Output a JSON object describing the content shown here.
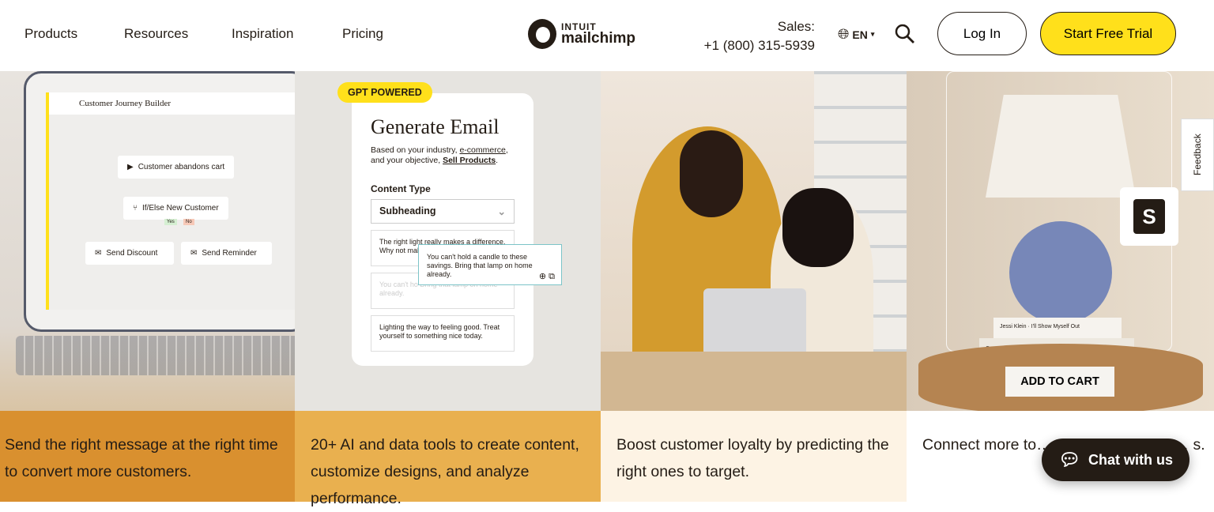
{
  "header": {
    "nav": [
      "Products",
      "Resources",
      "Inspiration",
      "Pricing"
    ],
    "logo_top": "INTUIT",
    "logo_bottom": "mailchimp",
    "sales_label": "Sales:",
    "sales_phone": "+1 (800) 315-5939",
    "language": "EN",
    "login": "Log In",
    "trial": "Start Free Trial",
    "accent": "#ffe01b"
  },
  "panel1": {
    "title": "Customer Journey Builder",
    "n1": "Customer abandons cart",
    "n2": "If/Else New Customer",
    "yes": "Yes",
    "no": "No",
    "n3": "Send Discount",
    "n4": "Send Reminder"
  },
  "panel2": {
    "badge": "GPT POWERED",
    "title": "Generate Email",
    "sub_a": "Based on your industry, ",
    "industry": "e-commerce",
    "sub_b": ", and your objective, ",
    "objective": "Sell Products",
    "content_type": "Content Type",
    "select": "Subheading",
    "opt1": "The right light really makes a difference. Why not mak",
    "opt2": "You can't ho Bring that lamp on home already.",
    "opt3": "Lighting the way to feeling good. Treat yourself to something nice today.",
    "popup": "You can't hold a candle to these savings. Bring that lamp on home already."
  },
  "panel4": {
    "add_to_cart": "ADD TO CART",
    "feedback": "Feedback",
    "book1": "Jessi Klein · I'll Show Myself Out",
    "book2": "Cannelle et Vanille · ARAN GOYOAGA"
  },
  "texts": [
    {
      "text": "Send the right message at the right time to convert more customers.",
      "bg": "#d9902f"
    },
    {
      "text": "20+ AI and data tools to create content, customize designs, and analyze performance.",
      "bg": "#e9b04f"
    },
    {
      "text": "Boost customer loyalty by predicting the right ones to target.",
      "bg": "#fdf3e4"
    },
    {
      "text": "Connect more to… save time, and m… s.",
      "bg": "#ffffff"
    }
  ],
  "chat": "Chat with us"
}
